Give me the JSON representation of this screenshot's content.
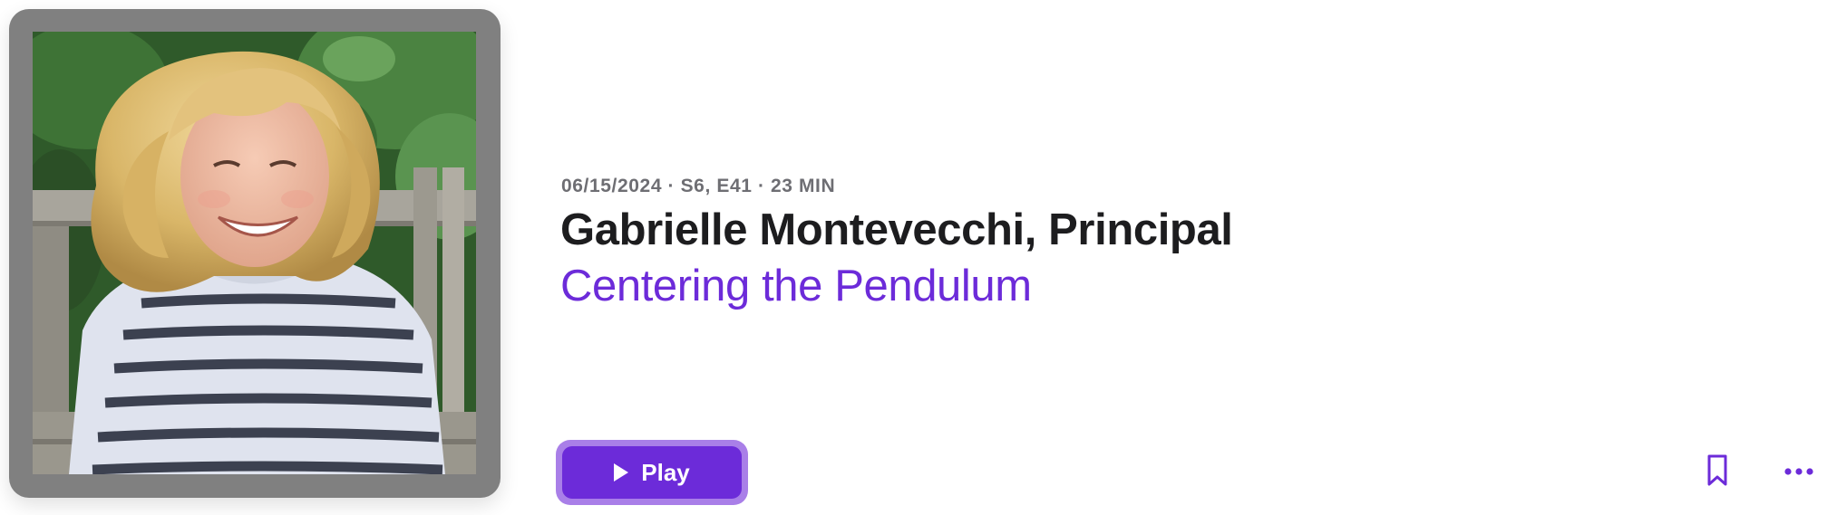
{
  "episode": {
    "date": "06/15/2024",
    "season_episode": "S6, E41",
    "duration": "23 MIN",
    "separator": "·",
    "title": "Gabrielle Montevecchi, Principal",
    "show_name": "Centering the Pendulum"
  },
  "actions": {
    "play_label": "Play",
    "play_icon": "play-icon",
    "bookmark_icon": "bookmark-icon",
    "more_icon": "more-icon"
  },
  "colors": {
    "accent": "#6c2bd9",
    "accent_ring": "#a97fe8",
    "title_text": "#1d1d1f",
    "meta_text": "#6e6e73",
    "artwork_frame": "#808080"
  }
}
